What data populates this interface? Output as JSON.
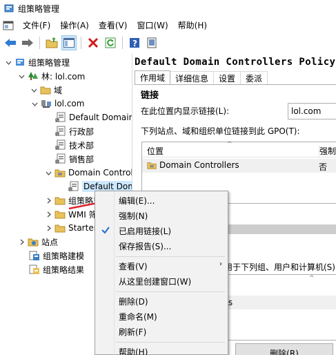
{
  "window": {
    "title": "组策略管理"
  },
  "menu": [
    "文件(F)",
    "操作(A)",
    "查看(V)",
    "窗口(W)",
    "帮助(H)"
  ],
  "toolbar": {
    "buttons": [
      "back-icon",
      "forward-icon",
      "up-folder-icon",
      "show-hide-tree-icon",
      "delete-icon",
      "refresh-icon",
      "help-icon",
      "properties-icon"
    ]
  },
  "tree": {
    "items": [
      {
        "label": "组策略管理",
        "icon": "gpm-icon",
        "expanded": true
      },
      {
        "label": "林: lol.com",
        "icon": "forest-icon",
        "expanded": true
      },
      {
        "label": "域",
        "icon": "folder-icon",
        "expanded": true
      },
      {
        "label": "lol.com",
        "icon": "domain-icon",
        "expanded": true
      },
      {
        "label": "Default Domain Policy",
        "icon": "gpo-link-icon"
      },
      {
        "label": "行政部",
        "icon": "gpo-link-icon"
      },
      {
        "label": "技术部",
        "icon": "gpo-link-icon"
      },
      {
        "label": "销售部",
        "icon": "gpo-link-icon"
      },
      {
        "label": "Domain Controllers",
        "icon": "ou-icon",
        "expanded": true
      },
      {
        "label": "Default Domain Controllers Policy",
        "icon": "gpo-link-icon",
        "selected": true
      },
      {
        "label": "组策略对象",
        "icon": "folder-icon",
        "collapsed": true
      },
      {
        "label": "WMI 筛选器",
        "icon": "folder-icon",
        "collapsed": true
      },
      {
        "label": "Starter GPO",
        "icon": "folder-icon",
        "collapsed": true
      },
      {
        "label": "站点",
        "icon": "sites-icon",
        "collapsed": true
      },
      {
        "label": "组策略建模",
        "icon": "modeling-icon"
      },
      {
        "label": "组策略结果",
        "icon": "results-icon"
      }
    ]
  },
  "details": {
    "title": "Default Domain Controllers Policy",
    "tabs": [
      "作用域",
      "详细信息",
      "设置",
      "委派"
    ],
    "active_tab": "作用域",
    "links_heading": "链接",
    "scope_label": "在此位置内显示链接(L):",
    "scope_value": "lol.com",
    "links_desc": "下列站点、域和组织单位链接到此 GPO(T):",
    "columns": [
      "位置",
      "强制"
    ],
    "rows": [
      {
        "location": "Domain Controllers",
        "enforced": "否"
      }
    ],
    "filter_label": "用于下列组、用户和计算机(S):",
    "filter_row": "rs",
    "delete_button": "删除(R)"
  },
  "context_menu": {
    "items": [
      {
        "label": "编辑(E)..."
      },
      {
        "label": "强制(N)"
      },
      {
        "label": "已启用链接(L)",
        "checked": true
      },
      {
        "label": "保存报告(S)..."
      },
      {
        "label": "查看(V)",
        "submenu": true
      },
      {
        "label": "从这里创建窗口(W)"
      },
      {
        "label": "删除(D)"
      },
      {
        "label": "重命名(M)"
      },
      {
        "label": "刷新(F)"
      },
      {
        "label": "帮助(H)"
      }
    ]
  },
  "colors": {
    "selection": "#cce8ff",
    "arrow": "#e0202a",
    "menu_bg": "#f2f2f2"
  }
}
